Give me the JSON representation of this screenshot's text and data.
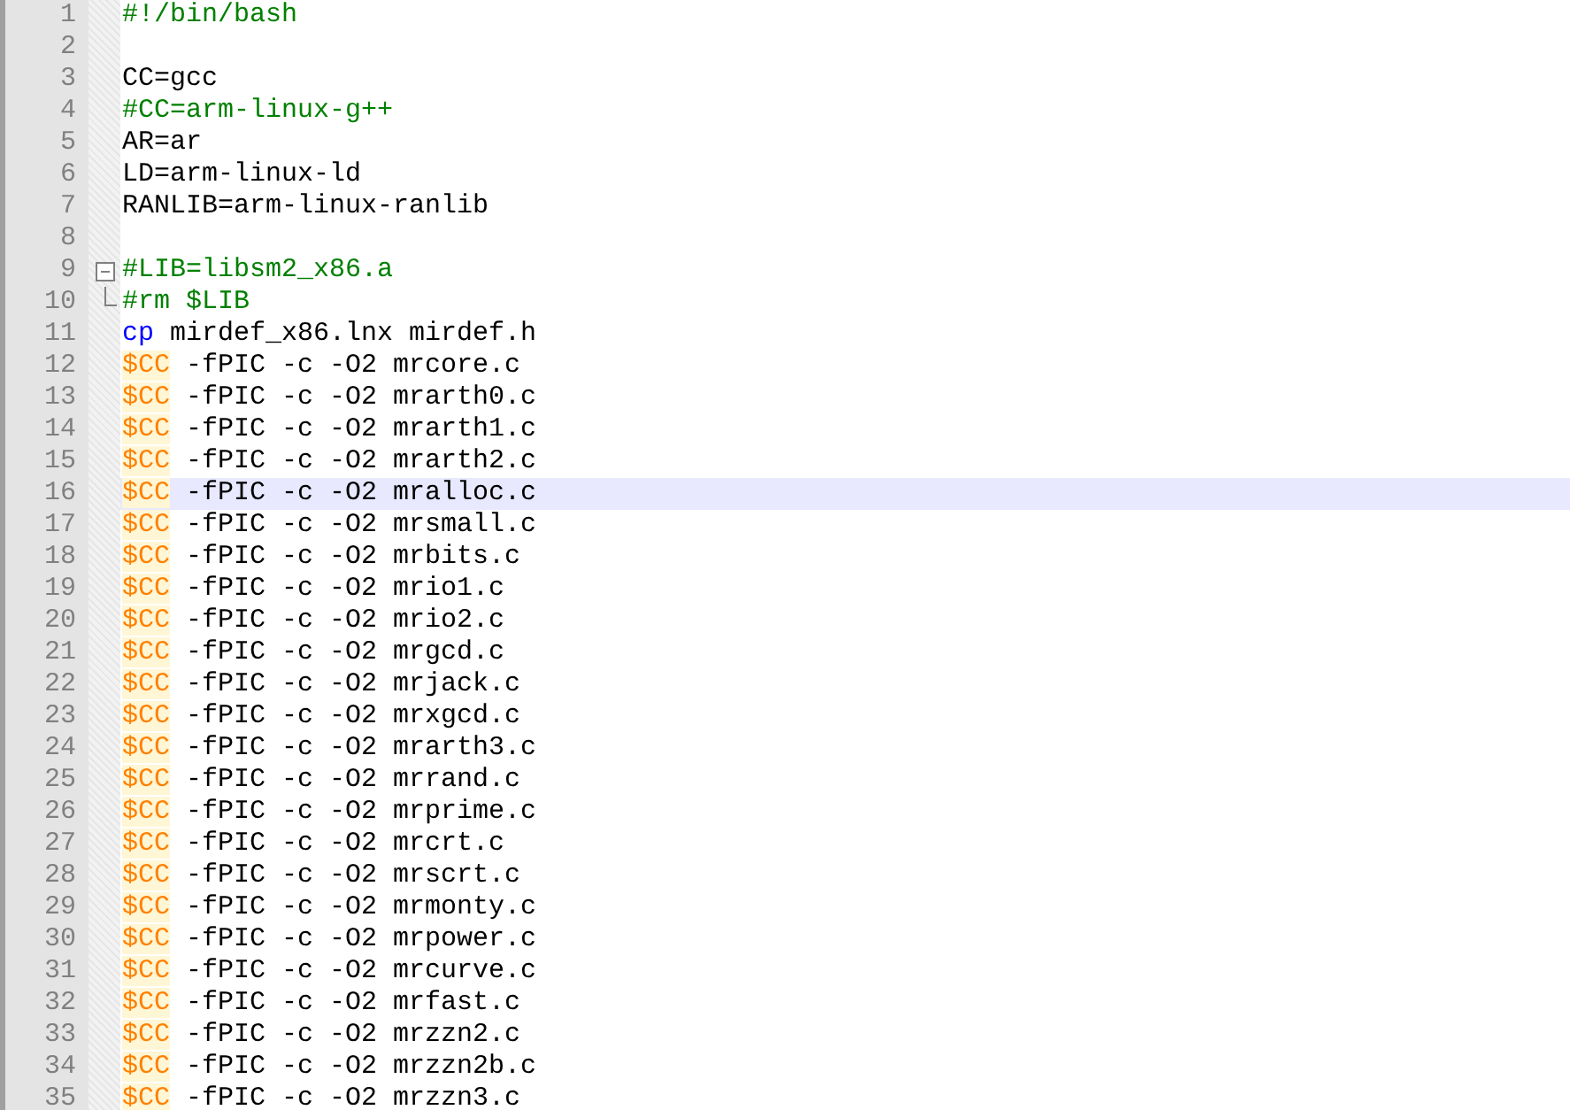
{
  "editor": {
    "lines": [
      {
        "number": "1",
        "current": false,
        "tokens": [
          {
            "kind": "comment",
            "text": "#!/bin/bash"
          }
        ]
      },
      {
        "number": "2",
        "current": false
      },
      {
        "number": "3",
        "current": false,
        "tokens": [
          {
            "kind": "plain",
            "text": "CC=gcc"
          }
        ]
      },
      {
        "number": "4",
        "current": false,
        "tokens": [
          {
            "kind": "comment",
            "text": "#CC=arm-linux-g++"
          }
        ]
      },
      {
        "number": "5",
        "current": false,
        "tokens": [
          {
            "kind": "plain",
            "text": "AR=ar"
          }
        ]
      },
      {
        "number": "6",
        "current": false,
        "tokens": [
          {
            "kind": "plain",
            "text": "LD=arm-linux-ld"
          }
        ]
      },
      {
        "number": "7",
        "current": false,
        "tokens": [
          {
            "kind": "plain",
            "text": "RANLIB=arm-linux-ranlib"
          }
        ]
      },
      {
        "number": "8",
        "current": false
      },
      {
        "number": "9",
        "current": false,
        "fold_open": true,
        "tokens": [
          {
            "kind": "comment",
            "text": "#LIB=libsm2_x86.a"
          }
        ]
      },
      {
        "number": "10",
        "current": false,
        "fold_close": true,
        "tokens": [
          {
            "kind": "comment",
            "text": "#rm $LIB"
          }
        ]
      },
      {
        "number": "11",
        "current": false,
        "tokens": [
          {
            "kind": "keyword",
            "text": "cp"
          },
          {
            "kind": "plain",
            "text": " mirdef_x86.lnx mirdef.h"
          }
        ]
      },
      {
        "number": "12",
        "current": false,
        "tokens": [
          {
            "kind": "variable",
            "text": "$CC"
          },
          {
            "kind": "plain",
            "text": " -fPIC -c -O2 mrcore.c"
          }
        ]
      },
      {
        "number": "13",
        "current": false,
        "tokens": [
          {
            "kind": "variable",
            "text": "$CC"
          },
          {
            "kind": "plain",
            "text": " -fPIC -c -O2 mrarth0.c"
          }
        ]
      },
      {
        "number": "14",
        "current": false,
        "tokens": [
          {
            "kind": "variable",
            "text": "$CC"
          },
          {
            "kind": "plain",
            "text": " -fPIC -c -O2 mrarth1.c"
          }
        ]
      },
      {
        "number": "15",
        "current": false,
        "tokens": [
          {
            "kind": "variable",
            "text": "$CC"
          },
          {
            "kind": "plain",
            "text": " -fPIC -c -O2 mrarth2.c"
          }
        ]
      },
      {
        "number": "16",
        "current": true,
        "tokens": [
          {
            "kind": "variable",
            "text": "$CC"
          },
          {
            "kind": "plain",
            "text": " -fPIC -c -O2 mralloc.c"
          }
        ]
      },
      {
        "number": "17",
        "current": false,
        "tokens": [
          {
            "kind": "variable",
            "text": "$CC"
          },
          {
            "kind": "plain",
            "text": " -fPIC -c -O2 mrsmall.c"
          }
        ]
      },
      {
        "number": "18",
        "current": false,
        "tokens": [
          {
            "kind": "variable",
            "text": "$CC"
          },
          {
            "kind": "plain",
            "text": " -fPIC -c -O2 mrbits.c"
          }
        ]
      },
      {
        "number": "19",
        "current": false,
        "tokens": [
          {
            "kind": "variable",
            "text": "$CC"
          },
          {
            "kind": "plain",
            "text": " -fPIC -c -O2 mrio1.c"
          }
        ]
      },
      {
        "number": "20",
        "current": false,
        "tokens": [
          {
            "kind": "variable",
            "text": "$CC"
          },
          {
            "kind": "plain",
            "text": " -fPIC -c -O2 mrio2.c"
          }
        ]
      },
      {
        "number": "21",
        "current": false,
        "tokens": [
          {
            "kind": "variable",
            "text": "$CC"
          },
          {
            "kind": "plain",
            "text": " -fPIC -c -O2 mrgcd.c"
          }
        ]
      },
      {
        "number": "22",
        "current": false,
        "tokens": [
          {
            "kind": "variable",
            "text": "$CC"
          },
          {
            "kind": "plain",
            "text": " -fPIC -c -O2 mrjack.c"
          }
        ]
      },
      {
        "number": "23",
        "current": false,
        "tokens": [
          {
            "kind": "variable",
            "text": "$CC"
          },
          {
            "kind": "plain",
            "text": " -fPIC -c -O2 mrxgcd.c"
          }
        ]
      },
      {
        "number": "24",
        "current": false,
        "tokens": [
          {
            "kind": "variable",
            "text": "$CC"
          },
          {
            "kind": "plain",
            "text": " -fPIC -c -O2 mrarth3.c"
          }
        ]
      },
      {
        "number": "25",
        "current": false,
        "tokens": [
          {
            "kind": "variable",
            "text": "$CC"
          },
          {
            "kind": "plain",
            "text": " -fPIC -c -O2 mrrand.c"
          }
        ]
      },
      {
        "number": "26",
        "current": false,
        "tokens": [
          {
            "kind": "variable",
            "text": "$CC"
          },
          {
            "kind": "plain",
            "text": " -fPIC -c -O2 mrprime.c"
          }
        ]
      },
      {
        "number": "27",
        "current": false,
        "tokens": [
          {
            "kind": "variable",
            "text": "$CC"
          },
          {
            "kind": "plain",
            "text": " -fPIC -c -O2 mrcrt.c"
          }
        ]
      },
      {
        "number": "28",
        "current": false,
        "tokens": [
          {
            "kind": "variable",
            "text": "$CC"
          },
          {
            "kind": "plain",
            "text": " -fPIC -c -O2 mrscrt.c"
          }
        ]
      },
      {
        "number": "29",
        "current": false,
        "tokens": [
          {
            "kind": "variable",
            "text": "$CC"
          },
          {
            "kind": "plain",
            "text": " -fPIC -c -O2 mrmonty.c"
          }
        ]
      },
      {
        "number": "30",
        "current": false,
        "tokens": [
          {
            "kind": "variable",
            "text": "$CC"
          },
          {
            "kind": "plain",
            "text": " -fPIC -c -O2 mrpower.c"
          }
        ]
      },
      {
        "number": "31",
        "current": false,
        "tokens": [
          {
            "kind": "variable",
            "text": "$CC"
          },
          {
            "kind": "plain",
            "text": " -fPIC -c -O2 mrcurve.c"
          }
        ]
      },
      {
        "number": "32",
        "current": false,
        "tokens": [
          {
            "kind": "variable",
            "text": "$CC"
          },
          {
            "kind": "plain",
            "text": " -fPIC -c -O2 mrfast.c"
          }
        ]
      },
      {
        "number": "33",
        "current": false,
        "tokens": [
          {
            "kind": "variable",
            "text": "$CC"
          },
          {
            "kind": "plain",
            "text": " -fPIC -c -O2 mrzzn2.c"
          }
        ]
      },
      {
        "number": "34",
        "current": false,
        "tokens": [
          {
            "kind": "variable",
            "text": "$CC"
          },
          {
            "kind": "plain",
            "text": " -fPIC -c -O2 mrzzn2b.c"
          }
        ]
      },
      {
        "number": "35",
        "current": false,
        "tokens": [
          {
            "kind": "variable",
            "text": "$CC"
          },
          {
            "kind": "plain",
            "text": " -fPIC -c -O2 mrzzn3.c"
          }
        ]
      }
    ]
  }
}
